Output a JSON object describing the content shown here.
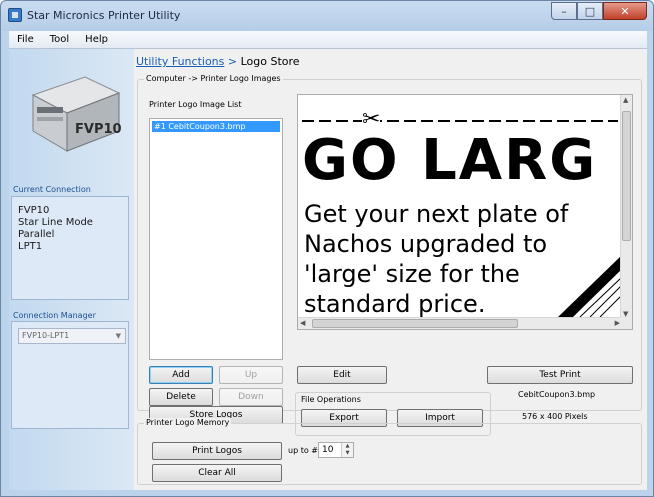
{
  "window": {
    "title": "Star Micronics Printer Utility"
  },
  "menubar": {
    "items": [
      {
        "label": "File"
      },
      {
        "label": "Tool"
      },
      {
        "label": "Help"
      }
    ]
  },
  "sidebar": {
    "printer_model": "FVP10",
    "current_connection_label": "Current Connection",
    "connection_lines": [
      "FVP10",
      "Star Line Mode",
      "Parallel",
      "LPT1"
    ],
    "connection_manager_label": "Connection Manager",
    "connection_selected": "FVP10-LPT1"
  },
  "breadcrumb": {
    "link": "Utility Functions",
    "separator": ">",
    "current": "Logo Store"
  },
  "logo_images": {
    "group_title": "Computer -> Printer Logo Images",
    "list_label": "Printer Logo Image List",
    "list_items": [
      "#1 CebitCoupon3.bmp"
    ],
    "preview": {
      "headline": "GO LARG",
      "body_lines": [
        "Get your next plate of",
        "Nachos upgraded to",
        "'large' size for the",
        "standard price."
      ]
    },
    "buttons": {
      "add": "Add",
      "up": "Up",
      "delete": "Delete",
      "down": "Down",
      "store": "Store Logos",
      "edit": "Edit",
      "test_print": "Test Print"
    },
    "file_operations": {
      "title": "File Operations",
      "export": "Export",
      "import": "Import"
    },
    "file_name": "CebitCoupon3.bmp",
    "dimensions": "576 x 400 Pixels"
  },
  "logo_memory": {
    "group_title": "Printer Logo Memory",
    "print_logos": "Print Logos",
    "up_to_label": "up to #",
    "up_to_value": "10",
    "clear_all": "Clear All"
  },
  "colors": {
    "sidebar_label": "#1f4f92",
    "link": "#1a5fb4",
    "selection": "#3399ff",
    "close_button": "#c2402a"
  }
}
